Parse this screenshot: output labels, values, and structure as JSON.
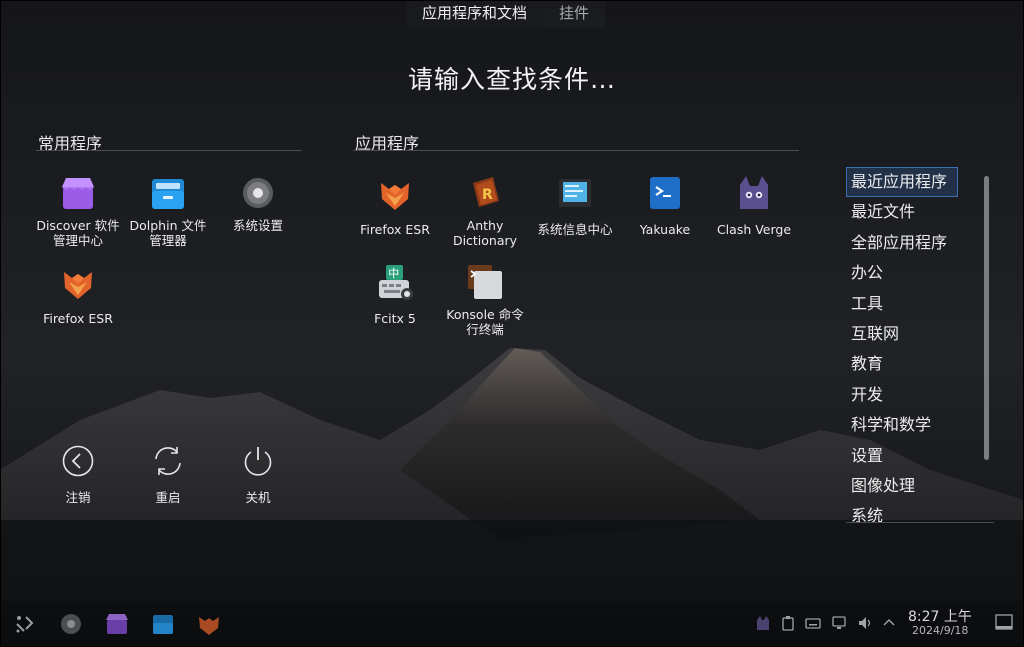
{
  "top_tabs": {
    "apps_docs": "应用程序和文档",
    "widgets": "挂件"
  },
  "search": {
    "prompt": "请输入查找条件…"
  },
  "favorites": {
    "title": "常用程序",
    "items": [
      {
        "label": "Discover 软件\n管理中心",
        "icon": "discover-icon"
      },
      {
        "label": "Dolphin 文件\n管理器",
        "icon": "dolphin-icon"
      },
      {
        "label": "系统设置",
        "icon": "settings-icon"
      },
      {
        "label": "Firefox ESR",
        "icon": "firefox-icon"
      }
    ]
  },
  "applications": {
    "title": "应用程序",
    "items": [
      {
        "label": "Firefox ESR",
        "icon": "firefox-icon"
      },
      {
        "label": "Anthy\nDictionary",
        "icon": "anthy-dictionary-icon"
      },
      {
        "label": "系统信息中心",
        "icon": "system-info-icon"
      },
      {
        "label": "Yakuake",
        "icon": "yakuake-icon"
      },
      {
        "label": "Clash Verge",
        "icon": "clash-verge-icon"
      },
      {
        "label": "Fcitx 5",
        "icon": "fcitx-icon"
      },
      {
        "label": "Konsole 命令\n行终端",
        "icon": "konsole-icon"
      }
    ]
  },
  "categories": {
    "selected_index": 0,
    "items": [
      "最近应用程序",
      "最近文件",
      "全部应用程序",
      "办公",
      "工具",
      "互联网",
      "教育",
      "开发",
      "科学和数学",
      "设置",
      "图像处理",
      "系统"
    ]
  },
  "power": {
    "logout": "注销",
    "restart": "重启",
    "shutdown": "关机"
  },
  "taskbar": {
    "time": "8:27 上午",
    "date": "2024/9/18",
    "pinned": [
      "kde-menu-icon",
      "settings-icon",
      "discover-icon",
      "dolphin-icon",
      "firefox-icon"
    ]
  },
  "colors": {
    "selection": "#3b6fb0",
    "background": "#101114"
  }
}
